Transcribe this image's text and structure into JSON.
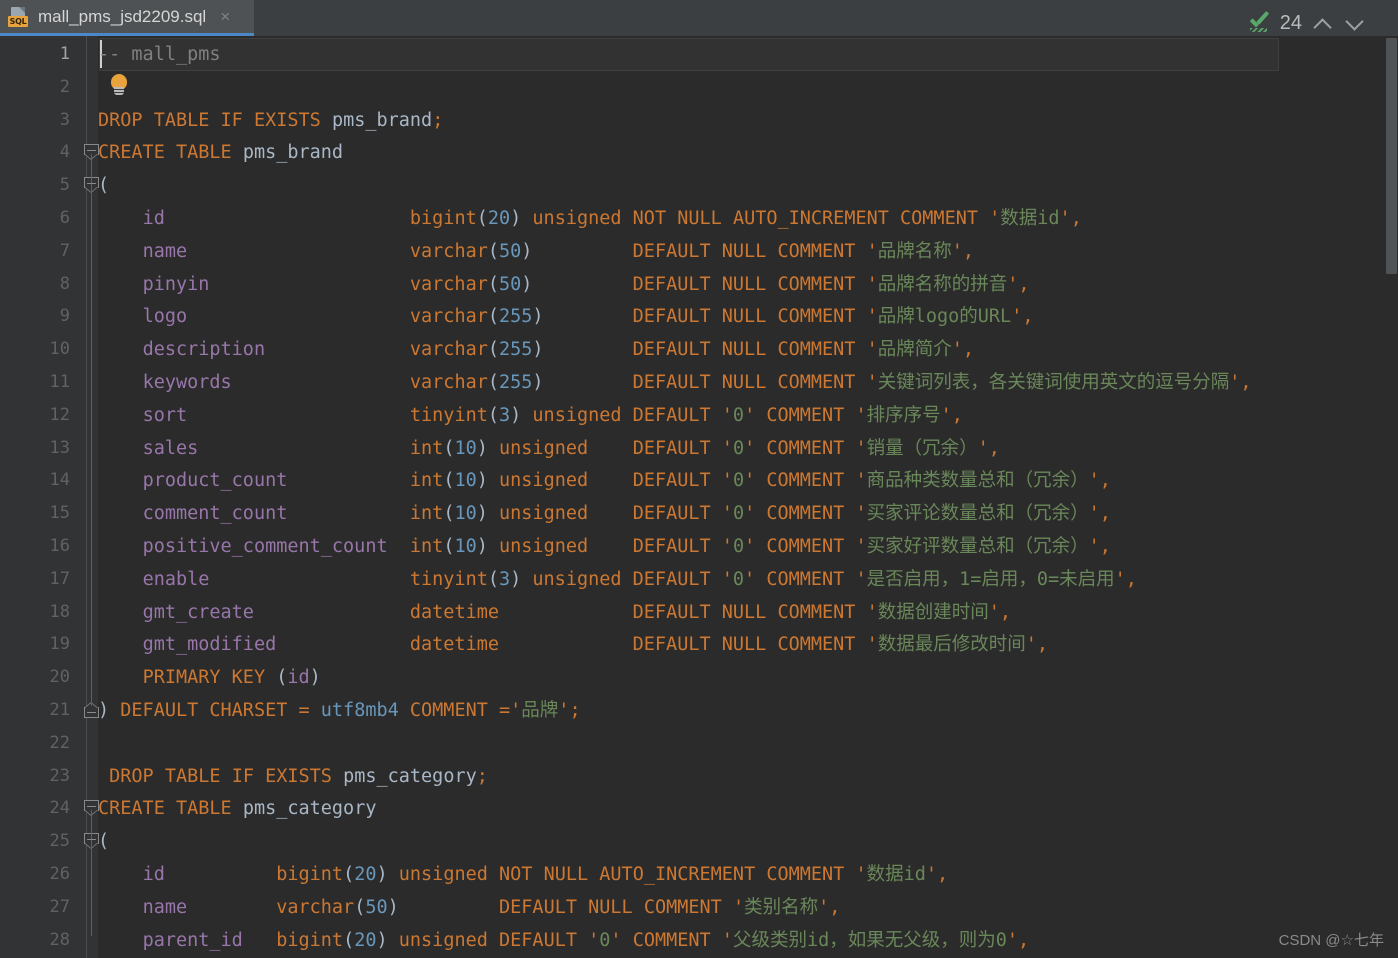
{
  "window": {
    "theme_bg": "#2b2b2b",
    "gutter_bg": "#313335",
    "tabbar_bg": "#3c3f41",
    "accent": "#4a88c7"
  },
  "tab": {
    "title": "mall_pms_jsd2209.sql",
    "icon_badge": "SQL",
    "close_label": "×"
  },
  "inspection_widget": {
    "status_icon": "green-check-icon",
    "count": "24",
    "prev_label": "∧",
    "next_label": "∨"
  },
  "watermark": {
    "text": "CSDN @☆七年"
  },
  "editor": {
    "language": "sql",
    "current_line": 1,
    "first_visible_line": 1,
    "last_visible_line": 28,
    "intention_bulb": "lightbulb-icon",
    "colors": {
      "keyword": "#cc7832",
      "identifier": "#9876aa",
      "number": "#6897bb",
      "string": "#6a8759",
      "comment": "#808080",
      "default_text": "#a9b7c6"
    },
    "lines": [
      {
        "n": 1,
        "text": "-- mall_pms"
      },
      {
        "n": 2,
        "text": ""
      },
      {
        "n": 3,
        "text": "DROP TABLE IF EXISTS pms_brand;"
      },
      {
        "n": 4,
        "text": "CREATE TABLE pms_brand"
      },
      {
        "n": 5,
        "text": "("
      },
      {
        "n": 6,
        "text": "    id                      bigint(20) unsigned NOT NULL AUTO_INCREMENT COMMENT '数据id',"
      },
      {
        "n": 7,
        "text": "    name                    varchar(50)         DEFAULT NULL COMMENT '品牌名称',"
      },
      {
        "n": 8,
        "text": "    pinyin                  varchar(50)         DEFAULT NULL COMMENT '品牌名称的拼音',"
      },
      {
        "n": 9,
        "text": "    logo                    varchar(255)        DEFAULT NULL COMMENT '品牌logo的URL',"
      },
      {
        "n": 10,
        "text": "    description             varchar(255)        DEFAULT NULL COMMENT '品牌简介',"
      },
      {
        "n": 11,
        "text": "    keywords                varchar(255)        DEFAULT NULL COMMENT '关键词列表，各关键词使用英文的逗号分隔',"
      },
      {
        "n": 12,
        "text": "    sort                    tinyint(3) unsigned DEFAULT '0' COMMENT '排序序号',"
      },
      {
        "n": 13,
        "text": "    sales                   int(10) unsigned    DEFAULT '0' COMMENT '销量（冗余）',"
      },
      {
        "n": 14,
        "text": "    product_count           int(10) unsigned    DEFAULT '0' COMMENT '商品种类数量总和（冗余）',"
      },
      {
        "n": 15,
        "text": "    comment_count           int(10) unsigned    DEFAULT '0' COMMENT '买家评论数量总和（冗余）',"
      },
      {
        "n": 16,
        "text": "    positive_comment_count  int(10) unsigned    DEFAULT '0' COMMENT '买家好评数量总和（冗余）',"
      },
      {
        "n": 17,
        "text": "    enable                  tinyint(3) unsigned DEFAULT '0' COMMENT '是否启用，1=启用，0=未启用',"
      },
      {
        "n": 18,
        "text": "    gmt_create              datetime            DEFAULT NULL COMMENT '数据创建时间',"
      },
      {
        "n": 19,
        "text": "    gmt_modified            datetime            DEFAULT NULL COMMENT '数据最后修改时间',"
      },
      {
        "n": 20,
        "text": "    PRIMARY KEY (id)"
      },
      {
        "n": 21,
        "text": ") DEFAULT CHARSET = utf8mb4 COMMENT ='品牌';"
      },
      {
        "n": 22,
        "text": ""
      },
      {
        "n": 23,
        "text": " DROP TABLE IF EXISTS pms_category;"
      },
      {
        "n": 24,
        "text": "CREATE TABLE pms_category"
      },
      {
        "n": 25,
        "text": "("
      },
      {
        "n": 26,
        "text": "    id          bigint(20) unsigned NOT NULL AUTO_INCREMENT COMMENT '数据id',"
      },
      {
        "n": 27,
        "text": "    name        varchar(50)         DEFAULT NULL COMMENT '类别名称',"
      },
      {
        "n": 28,
        "text": "    parent_id   bigint(20) unsigned DEFAULT '0' COMMENT '父级类别id，如果无父级，则为0',"
      }
    ],
    "fold_markers": [
      {
        "line": 4,
        "type": "start"
      },
      {
        "line": 5,
        "type": "start"
      },
      {
        "line": 21,
        "type": "end"
      },
      {
        "line": 24,
        "type": "start"
      },
      {
        "line": 25,
        "type": "start"
      }
    ]
  }
}
